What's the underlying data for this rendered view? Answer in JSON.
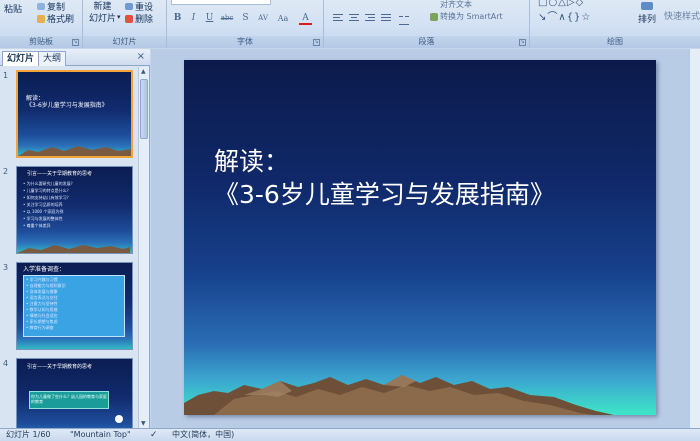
{
  "ribbon": {
    "clipboard": {
      "label": "剪贴板",
      "paste": "粘贴",
      "copy": "复制",
      "format_painter": "格式刷"
    },
    "slides": {
      "label": "幻灯片",
      "new_slide_line1": "新建",
      "new_slide_line2": "幻灯片",
      "reset": "重设",
      "delete": "删除"
    },
    "font": {
      "label": "字体",
      "bold": "B",
      "italic": "I",
      "underline": "U",
      "strike": "abc",
      "shadow": "S",
      "spacing": "AV",
      "case": "Aa",
      "color": "A"
    },
    "paragraph": {
      "label": "段落",
      "text_direction": "对齐文本",
      "smartart": "转换为 SmartArt"
    },
    "drawing": {
      "label": "绘图",
      "arrange": "排列",
      "quick_styles": "快速样式"
    }
  },
  "left_pane": {
    "tab_slides": "幻灯片",
    "tab_outline": "大纲",
    "close": "×",
    "thumbnails": [
      {
        "number": "1",
        "title_line1": "解读：",
        "title_line2": "《3-6岁儿童学习与发展指南》"
      },
      {
        "number": "2",
        "title": "引言——关于早期教育的思考",
        "body": [
          "• 为什么要研究儿童的发展？",
          "• 儿童学习的特点是什么？",
          "• 如何支持幼儿有效学习？",
          "• 关注学习品质的培养",
          "• 以 1000 个家庭为例",
          "• 学习与发展的整体性",
          "• 尊重个体差异"
        ]
      },
      {
        "number": "3",
        "title": "入学准备调查：",
        "body": [
          "• 学习兴趣与习惯",
          "• 自理能力与规则意识",
          "• 身体发展与健康",
          "• 语言表达与交往",
          "• 注意力与坚持性",
          "• 数学认知与思维",
          "• 情绪与社会适应",
          "• 家长期望与焦虑",
          "• 教育行为调查"
        ]
      },
      {
        "number": "4",
        "title": "引言——关于早期教育的思考",
        "box": "你为儿童做了些什么？幼儿园的教育与家庭的教育"
      }
    ]
  },
  "slide": {
    "title_line1": "解读：",
    "title_line2": "《3-6岁儿童学习与发展指南》"
  },
  "status": {
    "slide_counter": "幻灯片 1/60",
    "theme": "\"Mountain Top\"",
    "language": "中文(简体，中国)"
  },
  "colors": {
    "ribbon_bg": "#d2e1f3",
    "slide_top": "#0b1a4a",
    "slide_glow": "#3ee6c8",
    "selected_thumb_border": "#f3a33a"
  }
}
